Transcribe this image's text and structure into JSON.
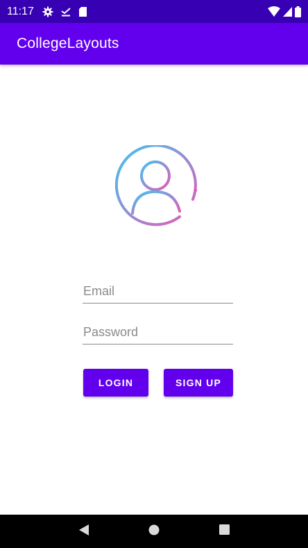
{
  "status_bar": {
    "time": "11:17",
    "icons_left": [
      "gear-icon",
      "download-done-icon",
      "sd-card-icon"
    ],
    "icons_right": [
      "wifi-icon",
      "signal-icon",
      "battery-icon"
    ]
  },
  "app_bar": {
    "title": "CollegeLayouts"
  },
  "login_form": {
    "avatar_icon": "user-profile-icon",
    "email_placeholder": "Email",
    "password_placeholder": "Password",
    "login_label": "LOGIN",
    "signup_label": "SIGN UP"
  },
  "nav_bar": {
    "icons": [
      "back-icon",
      "home-icon",
      "recents-icon"
    ]
  },
  "colors": {
    "primary": "#6200EE",
    "primary_dark": "#3700B3",
    "avatar_gradient_start": "#3EC6F0",
    "avatar_gradient_end": "#E957B5"
  }
}
